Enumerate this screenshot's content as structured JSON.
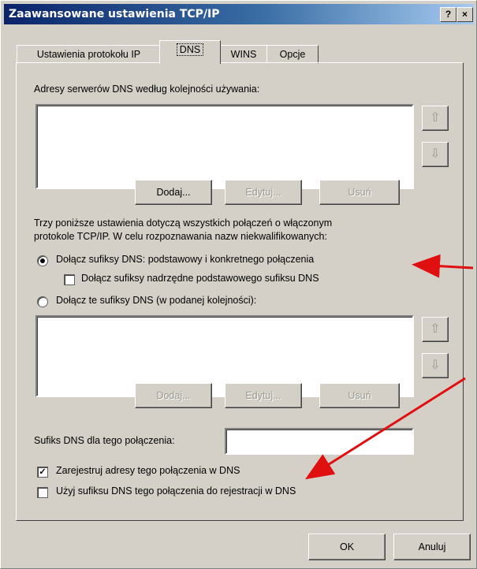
{
  "window": {
    "title": "Zaawansowane ustawienia TCP/IP",
    "help_label": "?",
    "close_label": "×"
  },
  "tabs": [
    {
      "label": "Ustawienia protokołu IP",
      "active": false
    },
    {
      "label": "DNS",
      "active": true
    },
    {
      "label": "WINS",
      "active": false
    },
    {
      "label": "Opcje",
      "active": false
    }
  ],
  "dns": {
    "servers_label": "Adresy serwerów DNS według kolejności używania:",
    "servers_list": [],
    "buttons": {
      "add": "Dodaj...",
      "edit": "Edytuj...",
      "remove": "Usuń"
    },
    "info_line1": "Trzy poniższe ustawienia dotyczą wszystkich połączeń o włączonym",
    "info_line2": "protokole TCP/IP. W celu rozpoznawania nazw niekwalifikowanych:",
    "radio_primary": {
      "label": "Dołącz sufiksy DNS: podstawowy i konkretnego połączenia",
      "checked": true
    },
    "check_parent": {
      "label": "Dołącz sufiksy nadrzędne podstawowego sufiksu DNS",
      "checked": false
    },
    "radio_these": {
      "label": "Dołącz te sufiksy DNS (w podanej kolejności):",
      "checked": false
    },
    "suffix_list": [],
    "buttons2": {
      "add": "Dodaj...",
      "edit": "Edytuj...",
      "remove": "Usuń"
    },
    "connection_suffix_label": "Sufiks DNS dla tego połączenia:",
    "connection_suffix_value": "",
    "register_check": {
      "label": "Zarejestruj adresy tego połączenia w DNS",
      "checked": true
    },
    "use_suffix_check": {
      "label": "Użyj sufiksu DNS tego połączenia do rejestracji w DNS",
      "checked": false
    }
  },
  "footer": {
    "ok": "OK",
    "cancel": "Anuluj"
  },
  "annotation_color": "#e01010"
}
